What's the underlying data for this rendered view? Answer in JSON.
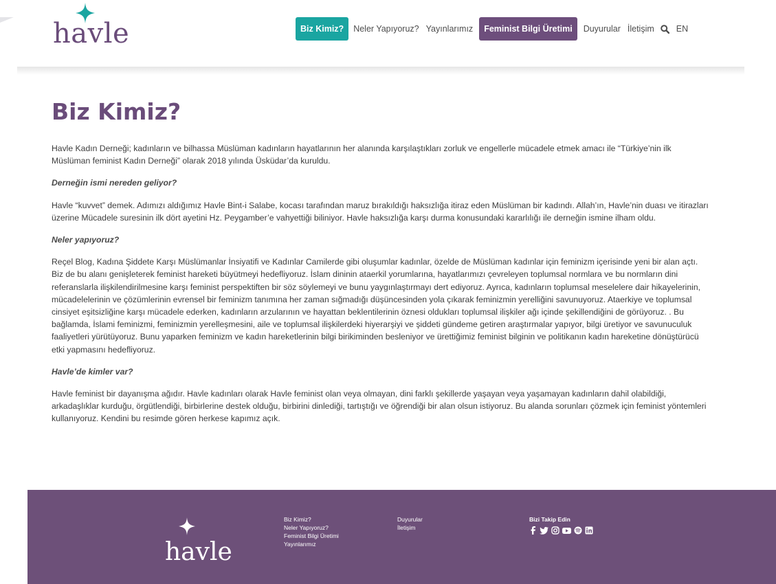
{
  "brand": {
    "logo_text": "havle"
  },
  "nav": {
    "items": [
      {
        "label": "Biz Kimiz?"
      },
      {
        "label": "Neler Yapıyoruz?"
      },
      {
        "label": "Yayınlarımız"
      },
      {
        "label": "Feminist Bilgi Üretimi"
      },
      {
        "label": "Duyurular"
      },
      {
        "label": "İletişim"
      }
    ],
    "search_icon": "search-icon",
    "language": "EN"
  },
  "page": {
    "title": "Biz Kimiz?",
    "intro": "Havle Kadın Derneği; kadınların ve bilhassa Müslüman kadınların hayatlarının her alanında karşılaştıkları zorluk ve engellerle mücadele etmek amacı ile “Türkiye’nin ilk Müslüman feminist Kadın Derneği” olarak 2018 yılında Üsküdar’da kuruldu.",
    "sections": [
      {
        "heading": "Derneğin ismi nereden geliyor?",
        "body": "Havle “kuvvet” demek. Adımızı aldığımız Havle Bint-i Salabe, kocası tarafından maruz bırakıldığı haksızlığa itiraz eden Müslüman bir kadındı. Allah’ın, Havle’nin duası ve itirazları üzerine Mücadele suresinin ilk dört ayetini Hz. Peygamber’e vahyettiği biliniyor. Havle haksızlığa karşı durma konusundaki kararlılığı ile derneğin ismine ilham oldu."
      },
      {
        "heading": "Neler yapıyoruz?",
        "body": "Reçel Blog, Kadına Şiddete Karşı Müslümanlar İnsiyatifi ve Kadınlar Camilerde gibi oluşumlar kadınlar, özelde de Müslüman kadınlar için feminizm içerisinde yeni bir alan açtı. Biz de bu alanı genişleterek feminist hareketi büyütmeyi hedefliyoruz.  İslam dininin ataerkil yorumlarına, hayatlarımızı çevreleyen toplumsal normlara ve bu normların dini referanslarla ilişkilendirilmesine karşı feminist perspektiften bir söz söylemeyi ve bunu yaygınlaştırmayı dert ediyoruz. Ayrıca, kadınların toplumsal meselelere dair hikayelerinin, mücadelelerinin ve çözümlerinin evrensel bir feminizm tanımına her zaman sığmadığı düşüncesinden yola çıkarak feminizmin yerelliğini savunuyoruz. Ataerkiye ve toplumsal cinsiyet eşitsizliğine karşı mücadele ederken, kadınların arzularının ve hayattan beklentilerinin öznesi oldukları toplumsal ilişkiler ağı içinde şekillendiğini de görüyoruz. . Bu bağlamda, İslami feminizmi, feminizmin yerelleşmesini, aile ve toplumsal ilişkilerdeki hiyerarşiyi ve şiddeti gündeme getiren araştırmalar yapıyor, bilgi üretiyor ve savunuculuk faaliyetleri yürütüyoruz. Bunu yaparken feminizm ve kadın hareketlerinin bilgi birikiminden besleniyor ve ürettiğimiz feminist bilginin ve politikanın kadın hareketine dönüştürücü etki yapmasını hedefliyoruz."
      },
      {
        "heading": "Havle’de kimler var?",
        "body": "Havle feminist bir dayanışma ağıdır. Havle kadınları olarak Havle feminist olan veya olmayan, dini farklı şekillerde yaşayan veya yaşamayan kadınların dahil olabildiği, arkadaşlıklar kurduğu, örgütlendiği, birbirlerine destek olduğu, birbirini dinlediği, tartıştığı ve öğrendiği bir alan olsun istiyoruz. Bu alanda sorunları çözmek için feminist yöntemleri kullanıyoruz. Kendini bu resimde gören herkese kapımız açık."
      }
    ]
  },
  "footer": {
    "logo_text": "havle",
    "col1": [
      "Biz Kimiz?",
      "Neler Yapıyoruz?",
      "Feminist Bilgi Üretimi",
      "Yayınlarımız"
    ],
    "col2": [
      "Duyurular",
      "İletişim"
    ],
    "follow_title": "Bizi Takip Edin",
    "social_icons": [
      "facebook-icon",
      "twitter-icon",
      "instagram-icon",
      "youtube-icon",
      "spotify-icon",
      "linkedin-icon"
    ]
  },
  "colors": {
    "brand_purple": "#6d4e7c",
    "teal": "#1aa5a1",
    "footer_bg": "#6d5079"
  }
}
